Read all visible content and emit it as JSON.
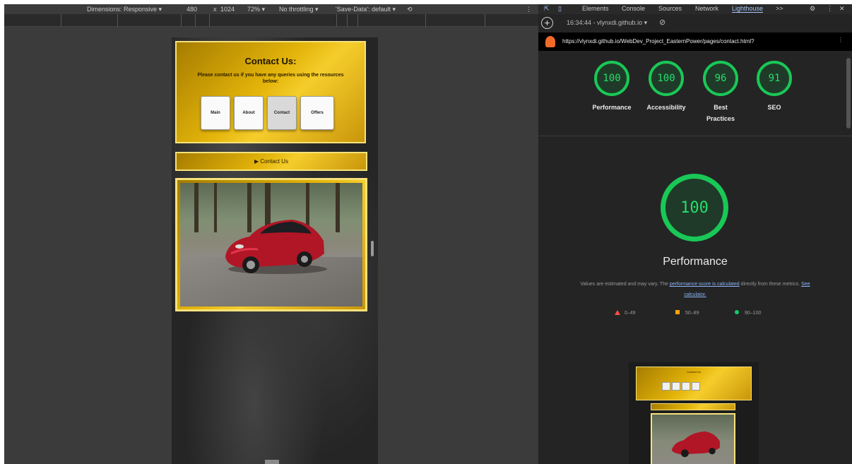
{
  "emulation": {
    "dimensions_label": "Dimensions: Responsive",
    "width": "480",
    "height_sep": "x",
    "height": "1024",
    "zoom": "72%",
    "throttling": "No throttling",
    "save_data": "'Save-Data': default"
  },
  "site": {
    "title": "Contact Us:",
    "subtitle": "Please contact us if you have any queries using the resources below:",
    "nav": [
      "Main",
      "About",
      "Contact",
      "Offers"
    ],
    "active_nav_index": 2,
    "toggle_label": "▶ Contact Us"
  },
  "devtools": {
    "tabs": [
      "Elements",
      "Console",
      "Sources",
      "Network",
      "Lighthouse"
    ],
    "more_tabs": ">>",
    "active_tab": "Lighthouse",
    "report_time": "16:34:44 - vlynxdi.github.io",
    "url": "https://vlynxdi.github.io/WebDev_Project_EasternPower/pages/contact.html?",
    "scores": [
      {
        "value": "100",
        "label": "Performance"
      },
      {
        "value": "100",
        "label": "Accessibility"
      },
      {
        "value": "96",
        "label": "Best Practices"
      },
      {
        "value": "91",
        "label": "SEO"
      }
    ],
    "main_score": "100",
    "main_label": "Performance",
    "desc_prefix": "Values are estimated and may vary. The ",
    "desc_link1": "performance score is calculated",
    "desc_middle": " directly from these metrics. ",
    "desc_link2": "See calculator.",
    "legend": [
      "0–49",
      "50–89",
      "90–100"
    ],
    "thumb_title": "Contact Us",
    "colors": {
      "pass": "#0cce6b",
      "average": "#ffa400",
      "fail": "#ff4e42",
      "link": "#8ab4f8"
    }
  }
}
